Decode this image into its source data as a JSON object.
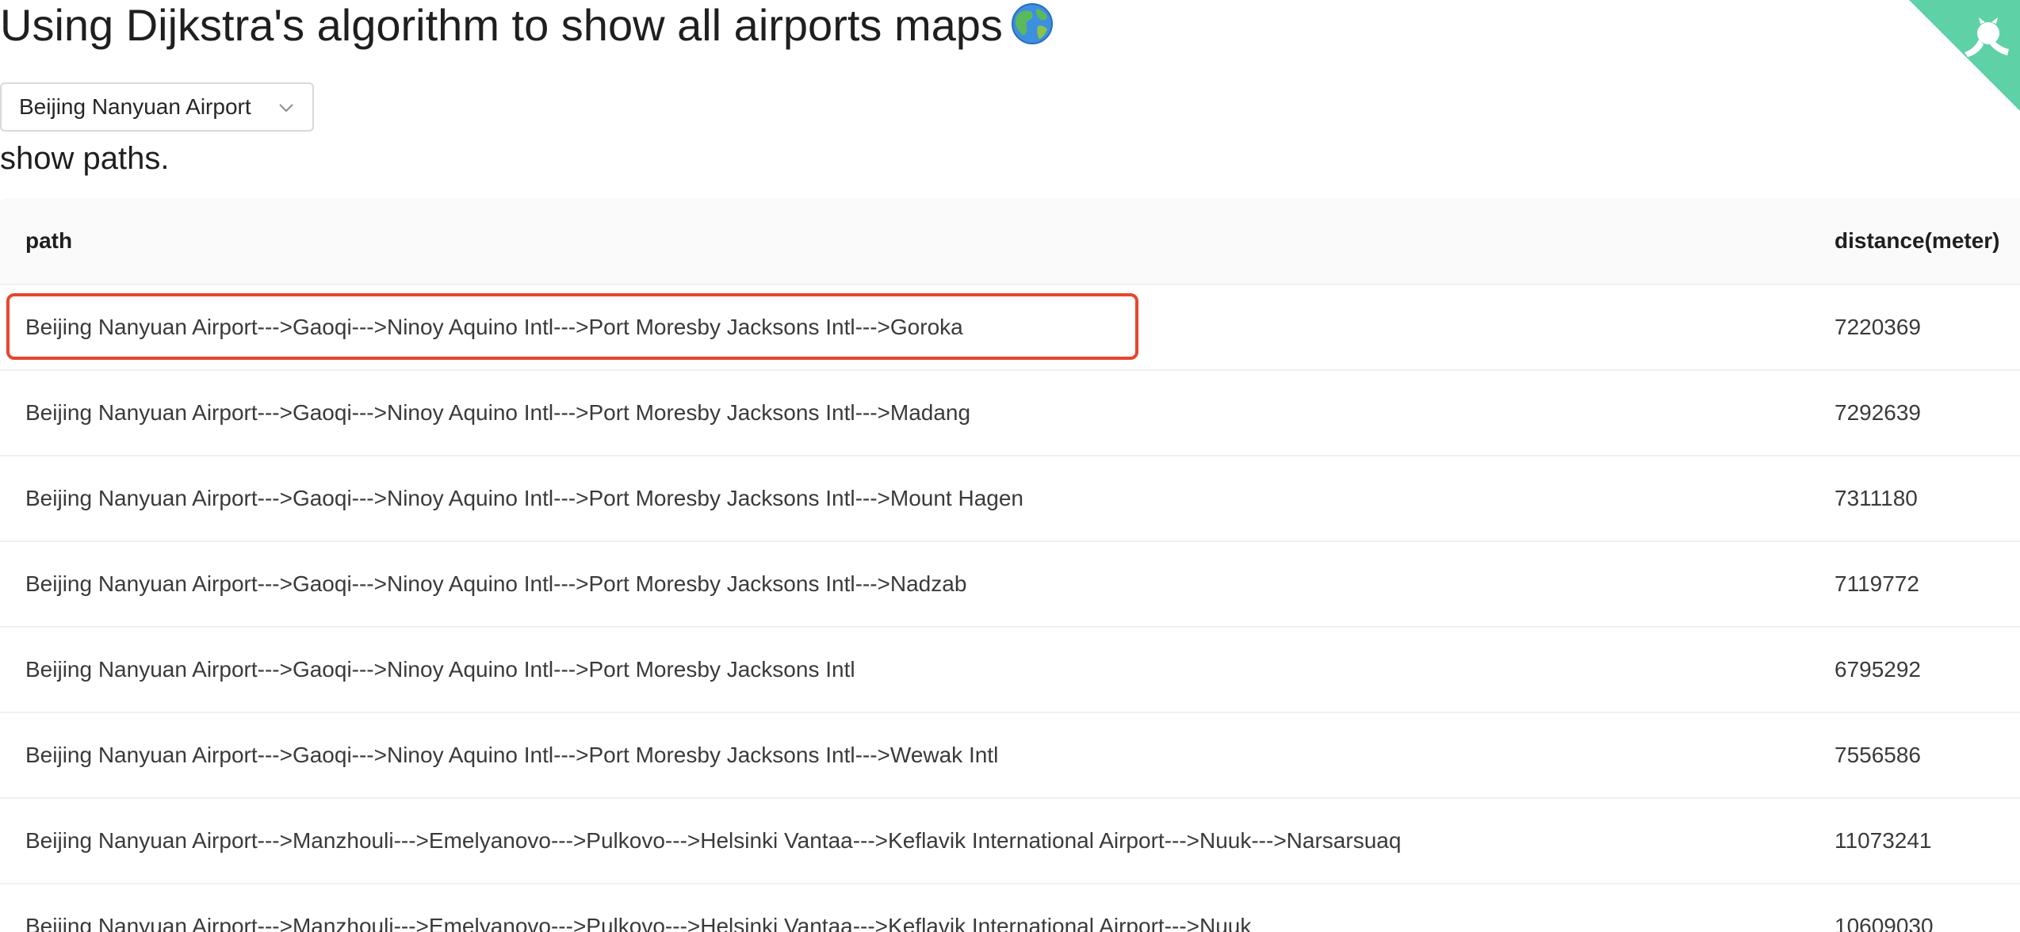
{
  "header": {
    "title": "Using Dijkstra's algorithm to show all airports maps",
    "title_icon": "globe-emoji",
    "corner_icon": "github-octocat-corner",
    "corner_color": "#5fd1a6"
  },
  "airport_select": {
    "value": "Beijing Nanyuan Airport"
  },
  "subtitle": "show paths.",
  "table": {
    "columns": [
      "path",
      "distance(meter)"
    ],
    "highlight_color": "#e8452c",
    "rows": [
      {
        "path": "Beijing Nanyuan Airport--->Gaoqi--->Ninoy Aquino Intl--->Port Moresby Jacksons Intl--->Goroka",
        "distance": "7220369",
        "highlighted": true
      },
      {
        "path": "Beijing Nanyuan Airport--->Gaoqi--->Ninoy Aquino Intl--->Port Moresby Jacksons Intl--->Madang",
        "distance": "7292639"
      },
      {
        "path": "Beijing Nanyuan Airport--->Gaoqi--->Ninoy Aquino Intl--->Port Moresby Jacksons Intl--->Mount Hagen",
        "distance": "7311180"
      },
      {
        "path": "Beijing Nanyuan Airport--->Gaoqi--->Ninoy Aquino Intl--->Port Moresby Jacksons Intl--->Nadzab",
        "distance": "7119772"
      },
      {
        "path": "Beijing Nanyuan Airport--->Gaoqi--->Ninoy Aquino Intl--->Port Moresby Jacksons Intl",
        "distance": "6795292"
      },
      {
        "path": "Beijing Nanyuan Airport--->Gaoqi--->Ninoy Aquino Intl--->Port Moresby Jacksons Intl--->Wewak Intl",
        "distance": "7556586"
      },
      {
        "path": "Beijing Nanyuan Airport--->Manzhouli--->Emelyanovo--->Pulkovo--->Helsinki Vantaa--->Keflavik International Airport--->Nuuk--->Narsarsuaq",
        "distance": "11073241"
      },
      {
        "path": "Beijing Nanyuan Airport--->Manzhouli--->Emelyanovo--->Pulkovo--->Helsinki Vantaa--->Keflavik International Airport--->Nuuk",
        "distance": "10609030"
      }
    ]
  }
}
